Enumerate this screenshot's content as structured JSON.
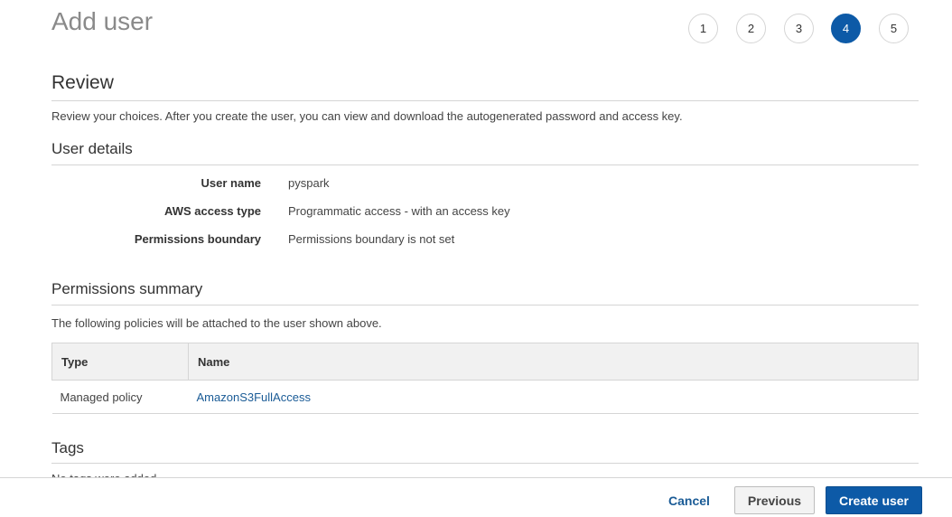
{
  "page": {
    "title": "Add user"
  },
  "steps": {
    "items": [
      "1",
      "2",
      "3",
      "4",
      "5"
    ],
    "active": "4"
  },
  "review": {
    "heading": "Review",
    "description": "Review your choices. After you create the user, you can view and download the autogenerated password and access key."
  },
  "user_details": {
    "heading": "User details",
    "rows": [
      {
        "label": "User name",
        "value": "pyspark"
      },
      {
        "label": "AWS access type",
        "value": "Programmatic access - with an access key"
      },
      {
        "label": "Permissions boundary",
        "value": "Permissions boundary is not set"
      }
    ]
  },
  "permissions": {
    "heading": "Permissions summary",
    "description": "The following policies will be attached to the user shown above.",
    "columns": [
      "Type",
      "Name"
    ],
    "rows": [
      {
        "type": "Managed policy",
        "name": "AmazonS3FullAccess"
      }
    ]
  },
  "tags": {
    "heading": "Tags",
    "text": "No tags were added."
  },
  "footer": {
    "cancel_label": "Cancel",
    "previous_label": "Previous",
    "create_label": "Create user"
  },
  "colors": {
    "primary": "#0d5aa7",
    "link": "#1a5b96",
    "border": "#d5d5d5",
    "table_header_bg": "#f1f1f1"
  }
}
